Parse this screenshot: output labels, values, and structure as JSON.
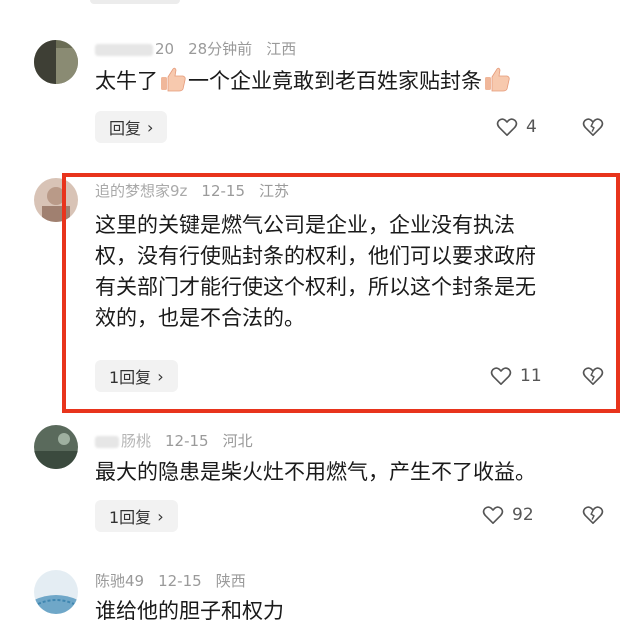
{
  "comments": [
    {
      "user_suffix": "20",
      "time": "28分钟前",
      "location": "江西",
      "text_parts": [
        "太牛了",
        "一个企业竟敢到老百姓家贴封条"
      ],
      "reply_label": "回复",
      "like_count": "4"
    },
    {
      "username": "追的梦想家9z",
      "time": "12-15",
      "location": "江苏",
      "text_lines": [
        "这里的关键是燃气公司是企业，企业没有执法",
        "权，没有行使贴封条的权利，他们可以要求政府",
        "有关部门才能行使这个权利，所以这个封条是无",
        "效的，也是不合法的。"
      ],
      "reply_label": "1回复",
      "like_count": "11"
    },
    {
      "username": "肠桃",
      "time": "12-15",
      "location": "河北",
      "text": "最大的隐患是柴火灶不用燃气，产生不了收益。",
      "reply_label": "1回复",
      "like_count": "92"
    },
    {
      "username": "陈驰49",
      "time": "12-15",
      "location": "陕西",
      "text": "谁给他的胆子和权力"
    }
  ],
  "colors": {
    "highlight": "#e8341c",
    "meta": "#9a9a9a"
  },
  "icons": [
    "thumbs-up-emoji",
    "heart-icon",
    "dislike-heart-icon",
    "chevron-right-icon"
  ]
}
